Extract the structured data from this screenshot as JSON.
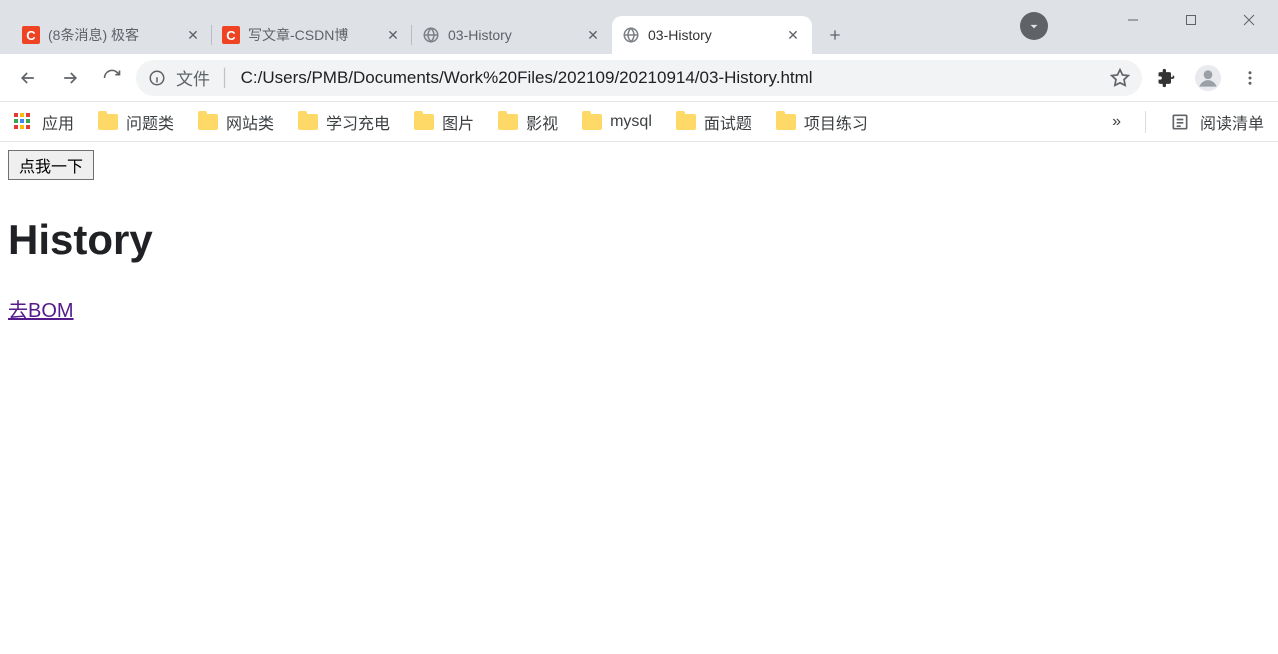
{
  "window": {
    "minimize": "–",
    "maximize": "☐",
    "close": "✕"
  },
  "tabs": [
    {
      "favicon": "C",
      "title": "(8条消息) 极客"
    },
    {
      "favicon": "C",
      "title": "写文章-CSDN博"
    },
    {
      "favicon": "globe",
      "title": "03-History"
    },
    {
      "favicon": "globe",
      "title": "03-History"
    }
  ],
  "active_tab_index": 3,
  "newtab_plus": "＋",
  "address_bar": {
    "file_label": "文件",
    "url": "C:/Users/PMB/Documents/Work%20Files/202109/20210914/03-History.html"
  },
  "bookmarks": {
    "apps_label": "应用",
    "items": [
      "问题类",
      "网站类",
      "学习充电",
      "图片",
      "影视",
      "mysql",
      "面试题",
      "项目练习"
    ],
    "reading_list": "阅读清单",
    "overflow": "»"
  },
  "page": {
    "button_label": "点我一下",
    "heading": "History",
    "link_text": "去BOM"
  }
}
